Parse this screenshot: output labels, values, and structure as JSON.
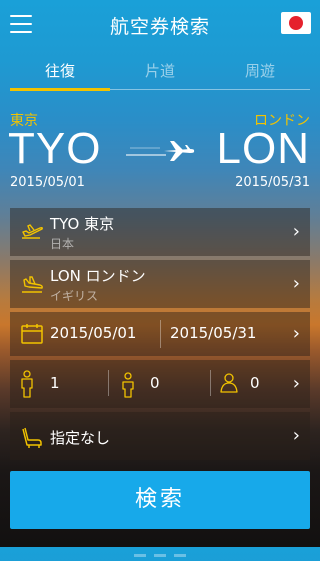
{
  "header": {
    "title": "航空券検索"
  },
  "tabs": [
    {
      "label": "往復",
      "active": true
    },
    {
      "label": "片道",
      "active": false
    },
    {
      "label": "周遊",
      "active": false
    }
  ],
  "route": {
    "origin": {
      "city": "東京",
      "code": "TYO",
      "date": "2015/05/01"
    },
    "destination": {
      "city": "ロンドン",
      "code": "LON",
      "date": "2015/05/31"
    }
  },
  "fields": {
    "departure": {
      "main": "TYO 東京",
      "sub": "日本"
    },
    "arrival": {
      "main": "LON ロンドン",
      "sub": "イギリス"
    },
    "dates": {
      "outbound": "2015/05/01",
      "return": "2015/05/31"
    },
    "passengers": {
      "adult": "1",
      "child": "0",
      "infant": "0"
    },
    "seat_class": {
      "value": "指定なし"
    }
  },
  "search_button": {
    "label": "検索"
  },
  "colors": {
    "accent": "#f2c300",
    "button": "#17a9ea"
  }
}
